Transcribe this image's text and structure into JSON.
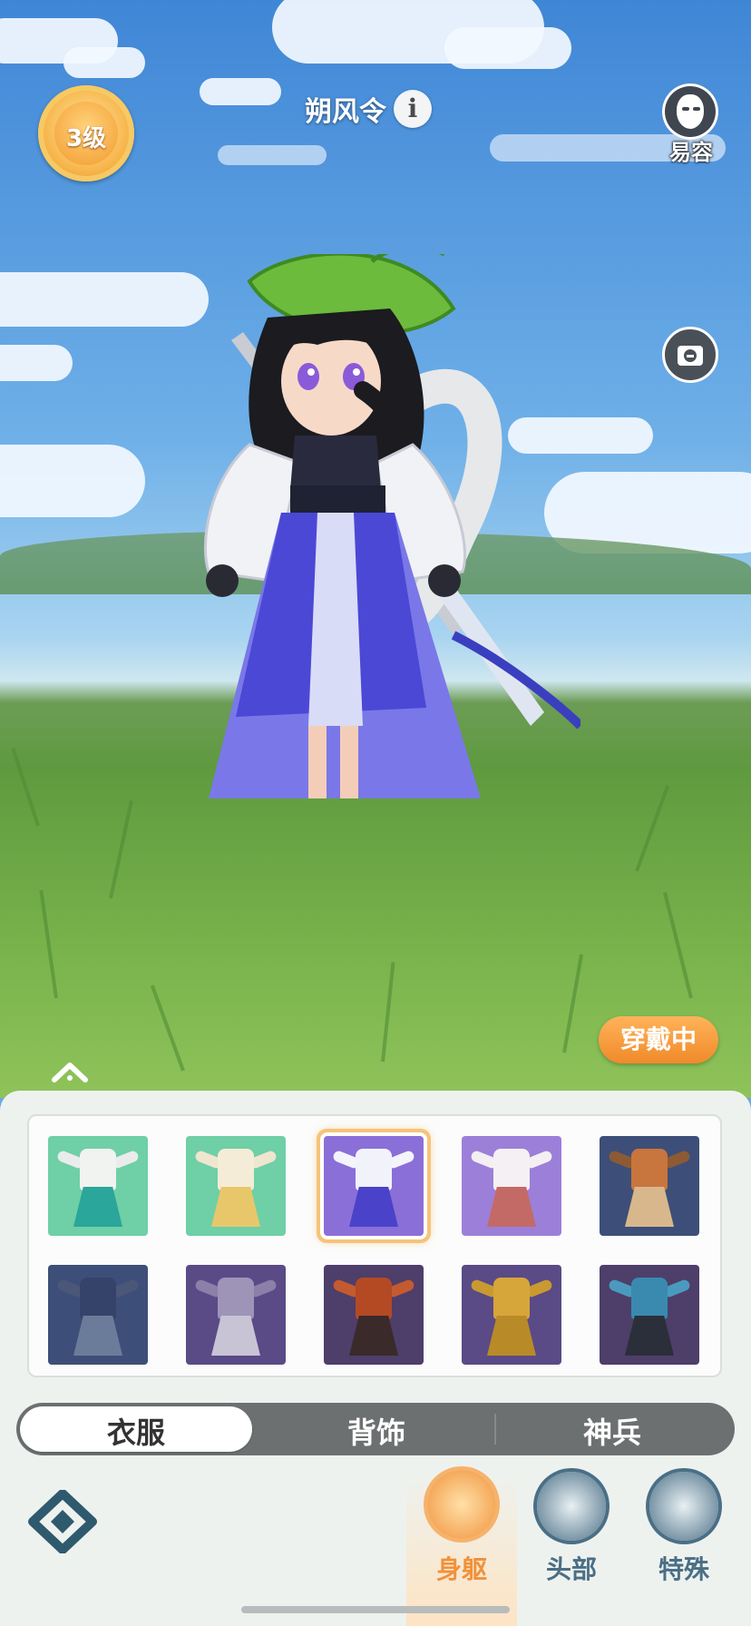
{
  "hud": {
    "level": "3级",
    "title": "朔风令",
    "face_label": "易容"
  },
  "status": {
    "equipped_label": "穿戴中"
  },
  "wardrobe": {
    "items": [
      {
        "bg": "#6fcfa6",
        "torso": "#f1f3f0",
        "skirt": "#2aa69a",
        "arm": "#e9ecea",
        "selected": false
      },
      {
        "bg": "#6fcfa6",
        "torso": "#f4ecd6",
        "skirt": "#e8c76a",
        "arm": "#efe6cf",
        "selected": false
      },
      {
        "bg": "#8a6fd8",
        "torso": "#f2f2fa",
        "skirt": "#4a42c8",
        "arm": "#f4f4fb",
        "selected": true
      },
      {
        "bg": "#9c7fd8",
        "torso": "#f4f0f4",
        "skirt": "#c46a66",
        "arm": "#f3eff2",
        "selected": false
      },
      {
        "bg": "#3d4f78",
        "torso": "#c9753e",
        "skirt": "#d9b78d",
        "arm": "#8d5a34",
        "selected": false
      },
      {
        "bg": "#3d4f78",
        "torso": "#35436a",
        "skirt": "#6b7c9a",
        "arm": "#4a5778",
        "selected": false
      },
      {
        "bg": "#5a4a86",
        "torso": "#9e94b8",
        "skirt": "#c9c3d6",
        "arm": "#8a80a8",
        "selected": false
      },
      {
        "bg": "#4e3e6a",
        "torso": "#b44a24",
        "skirt": "#3a2a2a",
        "arm": "#c45a30",
        "selected": false
      },
      {
        "bg": "#5a4a86",
        "torso": "#d6a63a",
        "skirt": "#b98a28",
        "arm": "#c99a30",
        "selected": false
      },
      {
        "bg": "#4e3e6a",
        "torso": "#3a8ab0",
        "skirt": "#2a2f3a",
        "arm": "#4a9ac0",
        "selected": false
      }
    ]
  },
  "tabs": {
    "clothes": "衣服",
    "back": "背饰",
    "weapon": "神兵"
  },
  "nav": {
    "body": "身躯",
    "head": "头部",
    "special": "特殊"
  },
  "colors": {
    "accent": "#f08a2a",
    "nav_active": "#f0923a",
    "nav_inactive": "#4a6f86"
  }
}
